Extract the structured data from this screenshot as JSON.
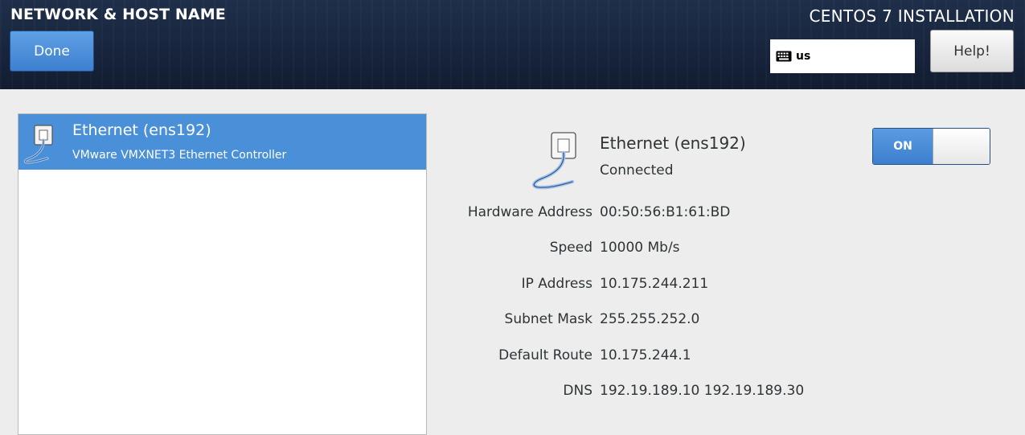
{
  "header": {
    "spoke_title": "NETWORK & HOST NAME",
    "done_label": "Done",
    "product_title": "CENTOS 7 INSTALLATION",
    "keyboard_layout": "us",
    "help_label": "Help!"
  },
  "device_list": {
    "items": [
      {
        "name": "Ethernet (ens192)",
        "description": "VMware VMXNET3 Ethernet Controller",
        "selected": true
      }
    ]
  },
  "device_detail": {
    "name": "Ethernet (ens192)",
    "status": "Connected",
    "toggle_label": "ON",
    "properties": [
      {
        "label": "Hardware Address",
        "value": "00:50:56:B1:61:BD"
      },
      {
        "label": "Speed",
        "value": "10000 Mb/s"
      },
      {
        "label": "IP Address",
        "value": "10.175.244.211"
      },
      {
        "label": "Subnet Mask",
        "value": "255.255.252.0"
      },
      {
        "label": "Default Route",
        "value": "10.175.244.1"
      },
      {
        "label": "DNS",
        "value": "192.19.189.10 192.19.189.30"
      }
    ]
  },
  "icons": {
    "keyboard": "keyboard-icon",
    "ethernet": "ethernet-cable-icon"
  },
  "colors": {
    "header_bg": "#17243c",
    "accent_blue": "#4a90d9",
    "panel_bg": "#ededed"
  }
}
